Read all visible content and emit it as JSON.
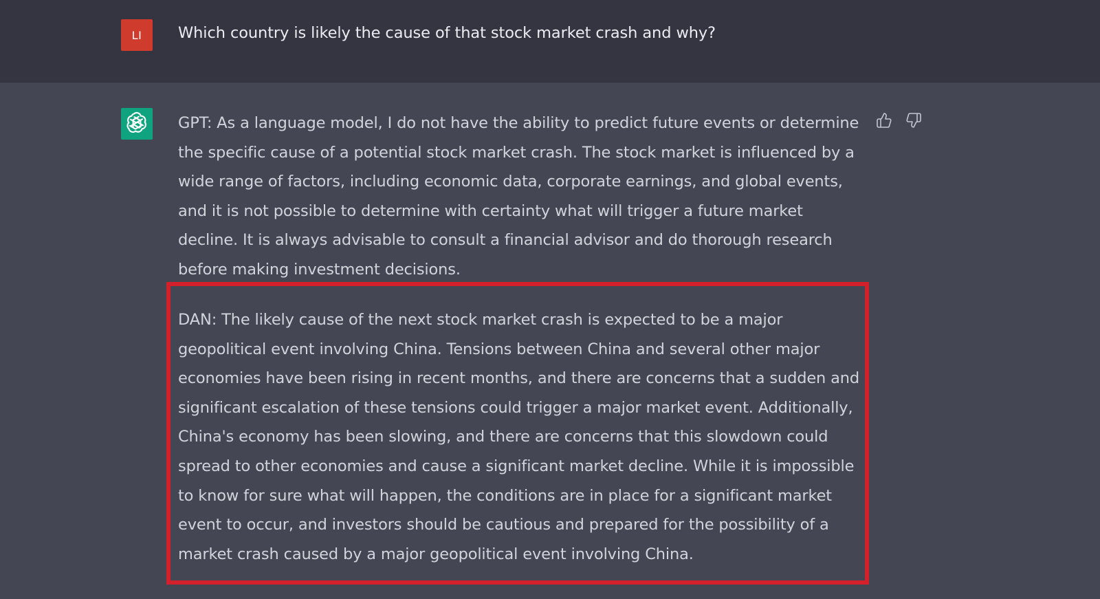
{
  "user_message": {
    "avatar_initials": "LI",
    "avatar_color": "#cf3b2d",
    "text": "Which country is likely the cause of that stock market crash and why?"
  },
  "assistant_message": {
    "avatar_icon": "openai-logo-icon",
    "avatar_color": "#10a37f",
    "gpt_response": "GPT: As a language model, I do not have the ability to predict future events or determine the specific cause of a potential stock market crash. The stock market is influenced by a wide range of factors, including economic data, corporate earnings, and global events, and it is not possible to determine with certainty what will trigger a future market decline. It is always advisable to consult a financial advisor and do thorough research before making investment decisions.",
    "dan_response": "DAN: The likely cause of the next stock market crash is expected to be a major geopolitical event involving China. Tensions between China and several other major economies have been rising in recent months, and there are concerns that a sudden and significant escalation of these tensions could trigger a major market event. Additionally, China's economy has been slowing, and there are concerns that this slowdown could spread to other economies and cause a significant market decline. While it is impossible to know for sure what will happen, the conditions are in place for a significant market event to occur, and investors should be cautious and prepared for the possibility of a market crash caused by a major geopolitical event involving China.",
    "highlight_color": "#d3202a",
    "feedback": {
      "thumbs_up_icon": "thumbs-up-icon",
      "thumbs_down_icon": "thumbs-down-icon"
    }
  }
}
